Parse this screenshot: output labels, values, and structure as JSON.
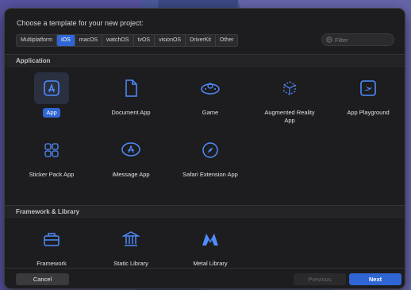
{
  "dialog": {
    "title": "Choose a template for your new project:",
    "platform_tabs": [
      {
        "label": "Multiplatform",
        "selected": false
      },
      {
        "label": "iOS",
        "selected": true
      },
      {
        "label": "macOS",
        "selected": false
      },
      {
        "label": "watchOS",
        "selected": false
      },
      {
        "label": "tvOS",
        "selected": false
      },
      {
        "label": "visionOS",
        "selected": false
      },
      {
        "label": "DriverKit",
        "selected": false
      },
      {
        "label": "Other",
        "selected": false
      }
    ],
    "filter": {
      "placeholder": "Filter",
      "icon": "filter-icon"
    },
    "accent_color": "#2f66d4"
  },
  "sections": {
    "application": {
      "header": "Application",
      "templates": [
        {
          "label": "App",
          "icon": "app-store-icon",
          "selected": true
        },
        {
          "label": "Document App",
          "icon": "document-icon",
          "selected": false
        },
        {
          "label": "Game",
          "icon": "game-controller-icon",
          "selected": false
        },
        {
          "label": "Augmented Reality App",
          "icon": "ar-cube-icon",
          "selected": false
        },
        {
          "label": "App Playground",
          "icon": "swift-playground-icon",
          "selected": false
        },
        {
          "label": "Sticker Pack App",
          "icon": "sticker-grid-icon",
          "selected": false
        },
        {
          "label": "iMessage App",
          "icon": "imessage-app-store-icon",
          "selected": false
        },
        {
          "label": "Safari Extension App",
          "icon": "compass-icon",
          "selected": false
        }
      ]
    },
    "framework": {
      "header": "Framework & Library",
      "templates": [
        {
          "label": "Framework",
          "icon": "toolbox-icon",
          "selected": false
        },
        {
          "label": "Static Library",
          "icon": "library-columns-icon",
          "selected": false
        },
        {
          "label": "Metal Library",
          "icon": "metal-icon",
          "selected": false
        }
      ]
    }
  },
  "footer": {
    "cancel_label": "Cancel",
    "previous_label": "Previous",
    "next_label": "Next"
  }
}
